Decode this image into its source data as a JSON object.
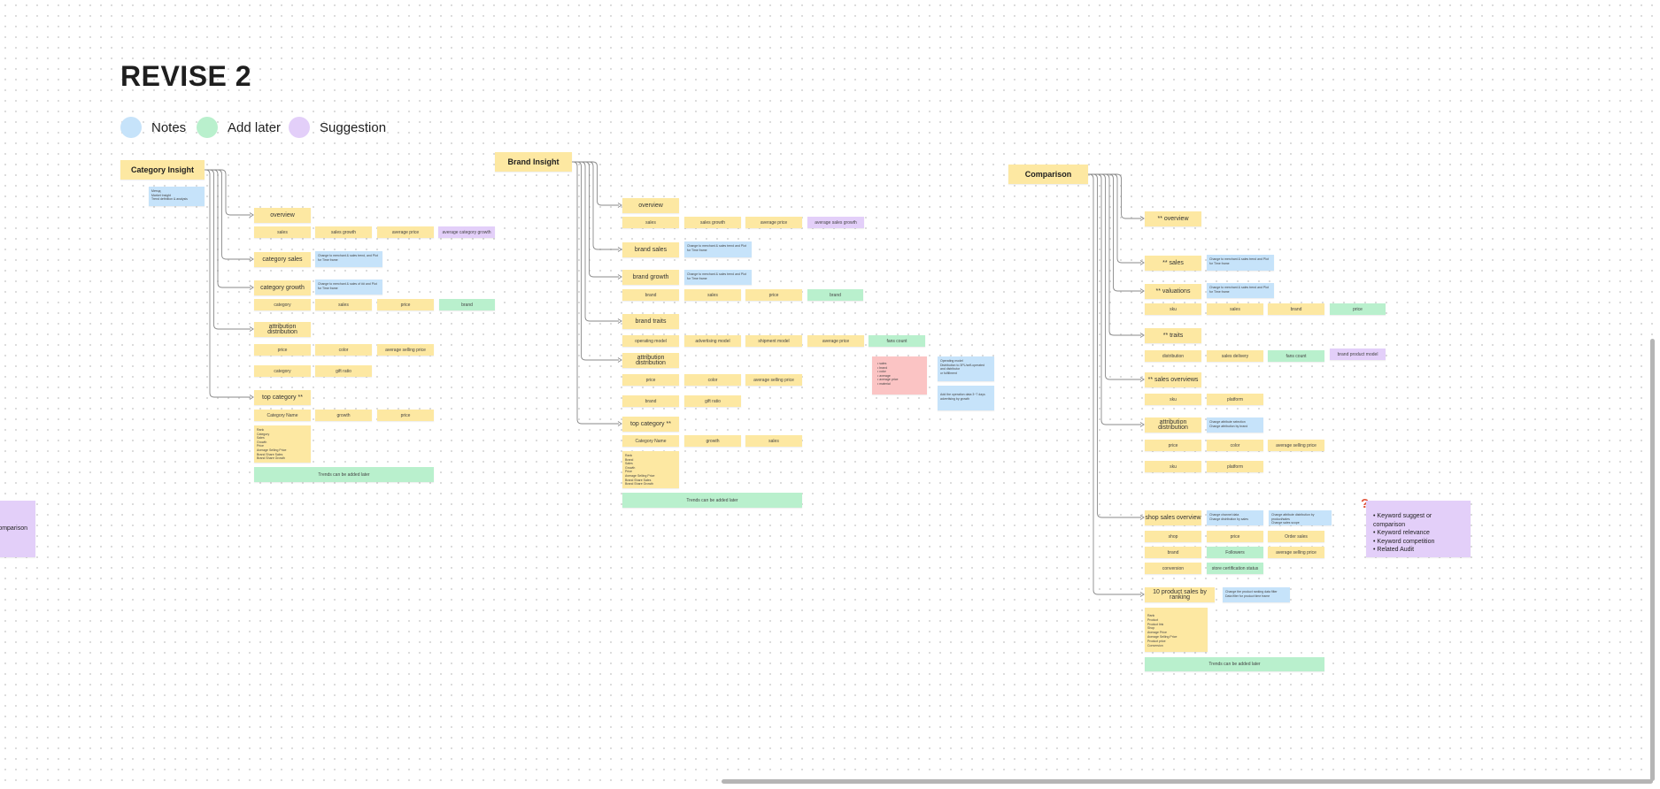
{
  "board": {
    "title": "REVISE 2",
    "legend": [
      {
        "label": "Notes",
        "color": "#c6e3fa"
      },
      {
        "label": "Add later",
        "color": "#b9f0cd"
      },
      {
        "label": "Suggestion",
        "color": "#e3cff9"
      }
    ]
  },
  "category_insight": {
    "title": "Category Insight",
    "note": "Метод:\nMarket Insight\nTrend definition & analysis",
    "sections": [
      "overview",
      "category sales",
      "category growth",
      "attribution distribution",
      "top category **"
    ],
    "overview_cells": [
      "sales",
      "sales growth",
      "average price",
      "average category growth"
    ],
    "sales_note": "Change to merchant & sales trend, and Plot for Time frame",
    "growth_note": "Change to merchant & sales of ## and Plot for Time frame",
    "growth_cells": [
      "category",
      "sales",
      "price",
      "brand"
    ],
    "attr_cells": [
      "price",
      "color",
      "average selling price"
    ],
    "attr_cells_2": [
      "category",
      "gift ratio"
    ],
    "top_cells": [
      "Category Name",
      "growth",
      "price"
    ],
    "top_list": "Rank\nCategory\nSales\nGrowth\nPrice\nAverage Selling Price\nBrand Share Sales\nBrand Share Growth",
    "trends": "Trends can be added later"
  },
  "brand_insight": {
    "title": "Brand Insight",
    "sections": [
      "overview",
      "brand sales",
      "brand growth",
      "brand traits",
      "attribution distribution",
      "top category **"
    ],
    "overview_cells": [
      "sales",
      "sales growth",
      "average price",
      "average sales growth"
    ],
    "sales_note": "Change to merchant & sales trend and Plot for Time frame",
    "growth_note": "Change to merchant & sales trend and Plot for Time frame",
    "growth_cells": [
      "brand",
      "sales",
      "price",
      "brand"
    ],
    "traits_cells": [
      "operating model",
      "advertising model",
      "shipment model",
      "average price",
      "fans count"
    ],
    "attr_cells": [
      "price",
      "color",
      "average selling price"
    ],
    "attr_cells_2": [
      "brand",
      "gift ratio"
    ],
    "top_cells": [
      "Category Name",
      "growth",
      "sales"
    ],
    "top_list": "Rank\nBrand\nSales\nGrowth\nPrice\nAverage Selling Price\nBrand Share Sales\nBrand Share Growth",
    "trends": "Trends can be added later",
    "red_list": "• sales\n• brand\n• color\n• average\n• average price\n• material",
    "side_note_1": "Operating model\nDistribution to 3PL/self-operated\nand distributor\nor fulfillment",
    "side_note_2": "Add the operation data 3~7 days\nadvertising by growth"
  },
  "comparison": {
    "title": "Comparison",
    "sections": [
      "** overview",
      "** sales",
      "** valuations",
      "** traits",
      "** sales overviews",
      "attribution distribution",
      "shop sales overview",
      "10 product sales by ranking"
    ],
    "sales_note": "Change to merchant & sales trend and Plot for Time frame",
    "val_note": "Change to merchant & sales trend and Plot for Time frame",
    "val_cells": [
      "sku",
      "sales",
      "brand",
      "price"
    ],
    "traits_cells": [
      "distribution",
      "sales delivery",
      "fans count",
      "brand product model"
    ],
    "so_cells": [
      "sku",
      "platform"
    ],
    "attr_note": "Change attribute selection\nChange attribution by brand",
    "attr_cells": [
      "price",
      "color",
      "average selling price"
    ],
    "attr_cells_2": [
      "sku",
      "platform"
    ],
    "shop_note_1": "Change channel data\nChange distribution by sales",
    "shop_note_2": "Change attribute distribution by product/sales\nChange sales scope",
    "shop_cells_1": [
      "shop",
      "price",
      "Order sales"
    ],
    "shop_cells_2": [
      "brand",
      "Followers",
      "average selling price"
    ],
    "shop_cells_3": [
      "conversion",
      "store certification status"
    ],
    "product_note": "Change the product ranking data filter\nData filter for product time frame",
    "product_list": "Rank\nProduct\nProduct link\nShop\nAverage Price\nAverage Selling Price\nProduct price\nConversion",
    "trends": "Trends can be added later",
    "suggestion": "• Keyword suggest or comparison\n• Keyword relevance\n• Keyword competition\n• Related Audit"
  },
  "offscreen": {
    "label": "omparison"
  }
}
